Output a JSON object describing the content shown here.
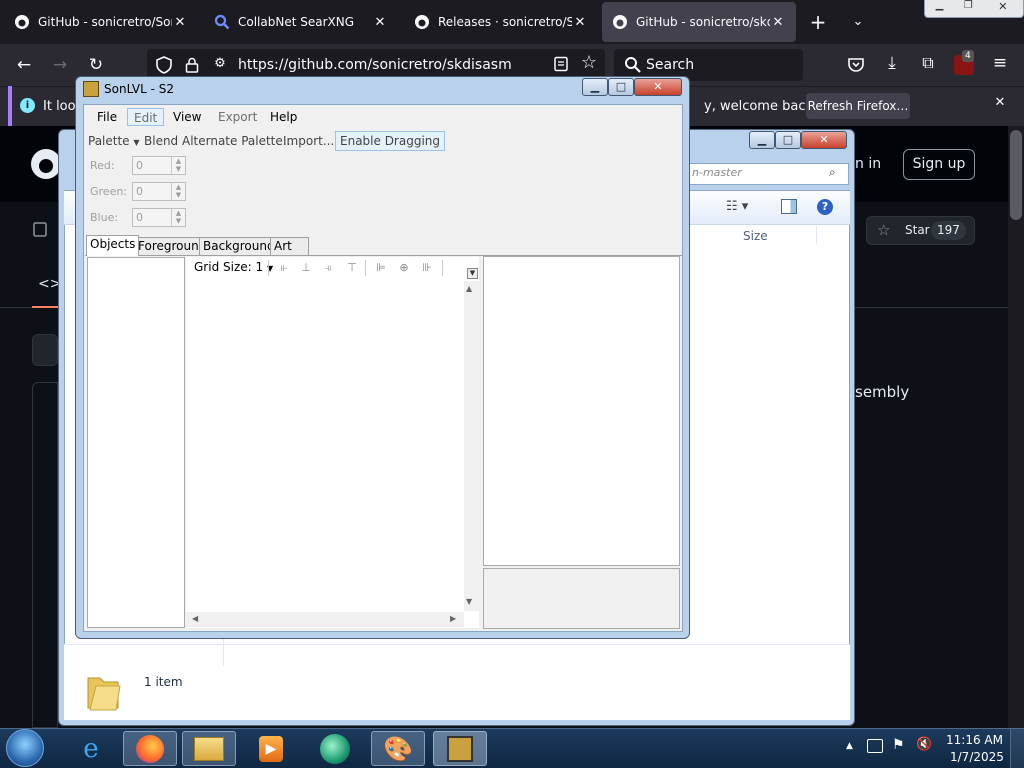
{
  "browser": {
    "tabs": [
      {
        "title": "GitHub - sonicretro/SonLVL",
        "active": false
      },
      {
        "title": "CollabNet SearXNG",
        "active": false
      },
      {
        "title": "Releases · sonicretro/SonLVL",
        "active": false
      },
      {
        "title": "GitHub - sonicretro/skdisasm",
        "active": true
      }
    ],
    "url": "https://github.com/sonicretro/skdisasm",
    "search_placeholder": "Search",
    "extension_badge": "4",
    "notification": {
      "text_left": "It look",
      "text_right": "y, welcome back!",
      "button": "Refresh Firefox…"
    }
  },
  "github": {
    "sign_in_fragment": "n in",
    "sign_up": "Sign up",
    "star_label": "Star",
    "star_count": "197",
    "assembly_fragment": "sembly"
  },
  "explorer": {
    "address_fragment": "n-master",
    "column_size": "Size",
    "status": "1 item"
  },
  "sonlvl": {
    "title": "SonLVL - S2",
    "menu": [
      "File",
      "Edit",
      "View",
      "Export",
      "Help"
    ],
    "toolbar": {
      "palette": "Palette",
      "blend": "Blend Alternate Palette...",
      "import": "Import...",
      "enable_dragging": "Enable Dragging"
    },
    "colors": {
      "red_label": "Red:",
      "red_value": "0",
      "green_label": "Green:",
      "green_value": "0",
      "blue_label": "Blue:",
      "blue_value": "0"
    },
    "tabs": [
      "Objects",
      "Foreground",
      "Background",
      "Art"
    ],
    "grid_size": "Grid Size: 1"
  },
  "taskbar": {
    "time": "11:16 AM",
    "date": "1/7/2025"
  }
}
